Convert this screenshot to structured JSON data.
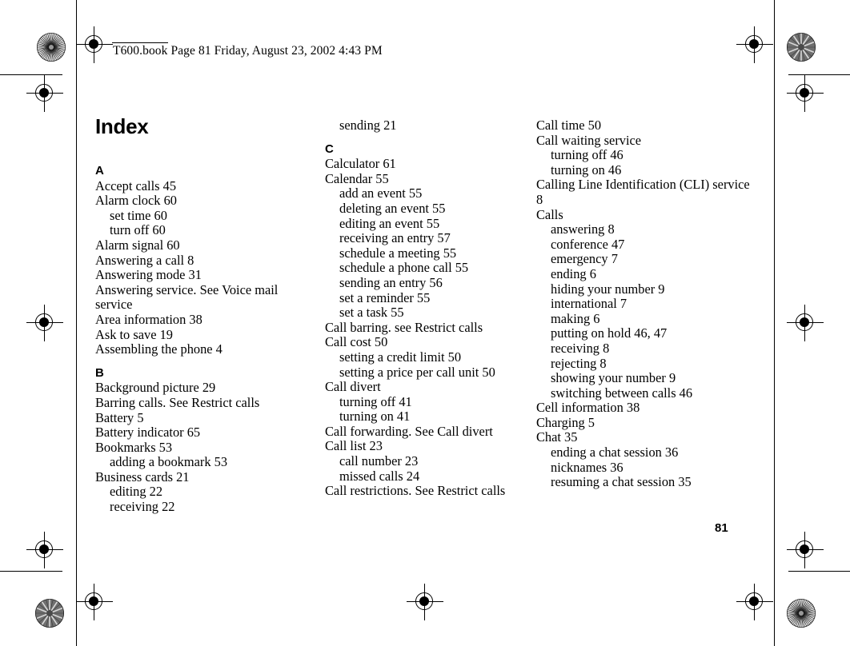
{
  "header": {
    "text": "T600.book  Page 81  Friday, August 23, 2002  4:43 PM"
  },
  "page": {
    "title": "Index",
    "number": "81"
  },
  "columns": [
    {
      "id": "col1",
      "blocks": [
        {
          "type": "letter",
          "text": "A"
        },
        {
          "type": "entry",
          "level": 0,
          "text": "Accept calls 45"
        },
        {
          "type": "entry",
          "level": 0,
          "text": "Alarm clock 60"
        },
        {
          "type": "entry",
          "level": 1,
          "text": "set time 60"
        },
        {
          "type": "entry",
          "level": 1,
          "text": "turn off 60"
        },
        {
          "type": "entry",
          "level": 0,
          "text": "Alarm signal 60"
        },
        {
          "type": "entry",
          "level": 0,
          "text": "Answering a call 8"
        },
        {
          "type": "entry",
          "level": 0,
          "text": "Answering mode 31"
        },
        {
          "type": "entry",
          "level": 0,
          "text": "Answering service. See Voice mail service"
        },
        {
          "type": "entry",
          "level": 0,
          "text": "Area information 38"
        },
        {
          "type": "entry",
          "level": 0,
          "text": "Ask to save 19"
        },
        {
          "type": "entry",
          "level": 0,
          "text": "Assembling the phone 4"
        },
        {
          "type": "letter",
          "text": "B"
        },
        {
          "type": "entry",
          "level": 0,
          "text": "Background picture 29"
        },
        {
          "type": "entry",
          "level": 0,
          "text": "Barring calls. See Restrict calls"
        },
        {
          "type": "entry",
          "level": 0,
          "text": "Battery 5"
        },
        {
          "type": "entry",
          "level": 0,
          "text": "Battery indicator 65"
        },
        {
          "type": "entry",
          "level": 0,
          "text": "Bookmarks 53"
        },
        {
          "type": "entry",
          "level": 1,
          "text": "adding a bookmark 53"
        },
        {
          "type": "entry",
          "level": 0,
          "text": "Business cards 21"
        },
        {
          "type": "entry",
          "level": 1,
          "text": "editing 22"
        },
        {
          "type": "entry",
          "level": 1,
          "text": "receiving 22"
        }
      ]
    },
    {
      "id": "col2",
      "blocks": [
        {
          "type": "entry",
          "level": 1,
          "text": "sending 21"
        },
        {
          "type": "letter",
          "text": "C"
        },
        {
          "type": "entry",
          "level": 0,
          "text": "Calculator 61"
        },
        {
          "type": "entry",
          "level": 0,
          "text": "Calendar 55"
        },
        {
          "type": "entry",
          "level": 1,
          "text": "add an event 55"
        },
        {
          "type": "entry",
          "level": 1,
          "text": "deleting an event 55"
        },
        {
          "type": "entry",
          "level": 1,
          "text": "editing an event 55"
        },
        {
          "type": "entry",
          "level": 1,
          "text": "receiving an entry 57"
        },
        {
          "type": "entry",
          "level": 1,
          "text": "schedule a meeting 55"
        },
        {
          "type": "entry",
          "level": 1,
          "text": "schedule a phone call 55"
        },
        {
          "type": "entry",
          "level": 1,
          "text": "sending an entry 56"
        },
        {
          "type": "entry",
          "level": 1,
          "text": "set a reminder 55"
        },
        {
          "type": "entry",
          "level": 1,
          "text": "set a task 55"
        },
        {
          "type": "entry",
          "level": 0,
          "text": "Call barring. see Restrict calls"
        },
        {
          "type": "entry",
          "level": 0,
          "text": "Call cost 50"
        },
        {
          "type": "entry",
          "level": 1,
          "text": "setting a credit limit 50"
        },
        {
          "type": "entry",
          "level": 1,
          "text": "setting a price per call unit 50"
        },
        {
          "type": "entry",
          "level": 0,
          "text": "Call divert"
        },
        {
          "type": "entry",
          "level": 1,
          "text": "turning off 41"
        },
        {
          "type": "entry",
          "level": 1,
          "text": "turning on 41"
        },
        {
          "type": "entry",
          "level": 0,
          "text": "Call forwarding. See Call divert"
        },
        {
          "type": "entry",
          "level": 0,
          "text": "Call list 23"
        },
        {
          "type": "entry",
          "level": 1,
          "text": "call number 23"
        },
        {
          "type": "entry",
          "level": 1,
          "text": "missed calls 24"
        },
        {
          "type": "entry",
          "level": 0,
          "text": "Call restrictions. See Restrict calls"
        }
      ]
    },
    {
      "id": "col3",
      "blocks": [
        {
          "type": "entry",
          "level": 0,
          "text": "Call time 50"
        },
        {
          "type": "entry",
          "level": 0,
          "text": "Call waiting service"
        },
        {
          "type": "entry",
          "level": 1,
          "text": "turning off 46"
        },
        {
          "type": "entry",
          "level": 1,
          "text": "turning on 46"
        },
        {
          "type": "entry",
          "level": 0,
          "text": "Calling Line Identification (CLI) service 8"
        },
        {
          "type": "entry",
          "level": 0,
          "text": "Calls"
        },
        {
          "type": "entry",
          "level": 1,
          "text": "answering 8"
        },
        {
          "type": "entry",
          "level": 1,
          "text": "conference 47"
        },
        {
          "type": "entry",
          "level": 1,
          "text": "emergency 7"
        },
        {
          "type": "entry",
          "level": 1,
          "text": "ending 6"
        },
        {
          "type": "entry",
          "level": 1,
          "text": "hiding your number 9"
        },
        {
          "type": "entry",
          "level": 1,
          "text": "international 7"
        },
        {
          "type": "entry",
          "level": 1,
          "text": "making 6"
        },
        {
          "type": "entry",
          "level": 1,
          "text": "putting on hold 46, 47"
        },
        {
          "type": "entry",
          "level": 1,
          "text": "receiving 8"
        },
        {
          "type": "entry",
          "level": 1,
          "text": "rejecting 8"
        },
        {
          "type": "entry",
          "level": 1,
          "text": "showing your number 9"
        },
        {
          "type": "entry",
          "level": 1,
          "text": "switching between calls 46"
        },
        {
          "type": "entry",
          "level": 0,
          "text": "Cell information 38"
        },
        {
          "type": "entry",
          "level": 0,
          "text": "Charging 5"
        },
        {
          "type": "entry",
          "level": 0,
          "text": "Chat 35"
        },
        {
          "type": "entry",
          "level": 1,
          "text": "ending a chat session 36"
        },
        {
          "type": "entry",
          "level": 1,
          "text": "nicknames 36"
        },
        {
          "type": "entry",
          "level": 1,
          "text": "resuming a chat session 35"
        }
      ]
    }
  ],
  "print_marks": {
    "registration_icon": "registration-target-icon",
    "starburst_icon": "starburst-density-icon",
    "count_registration": 8,
    "count_starburst": 4
  },
  "colors": {
    "ink": "#000000",
    "paper": "#ffffff"
  }
}
